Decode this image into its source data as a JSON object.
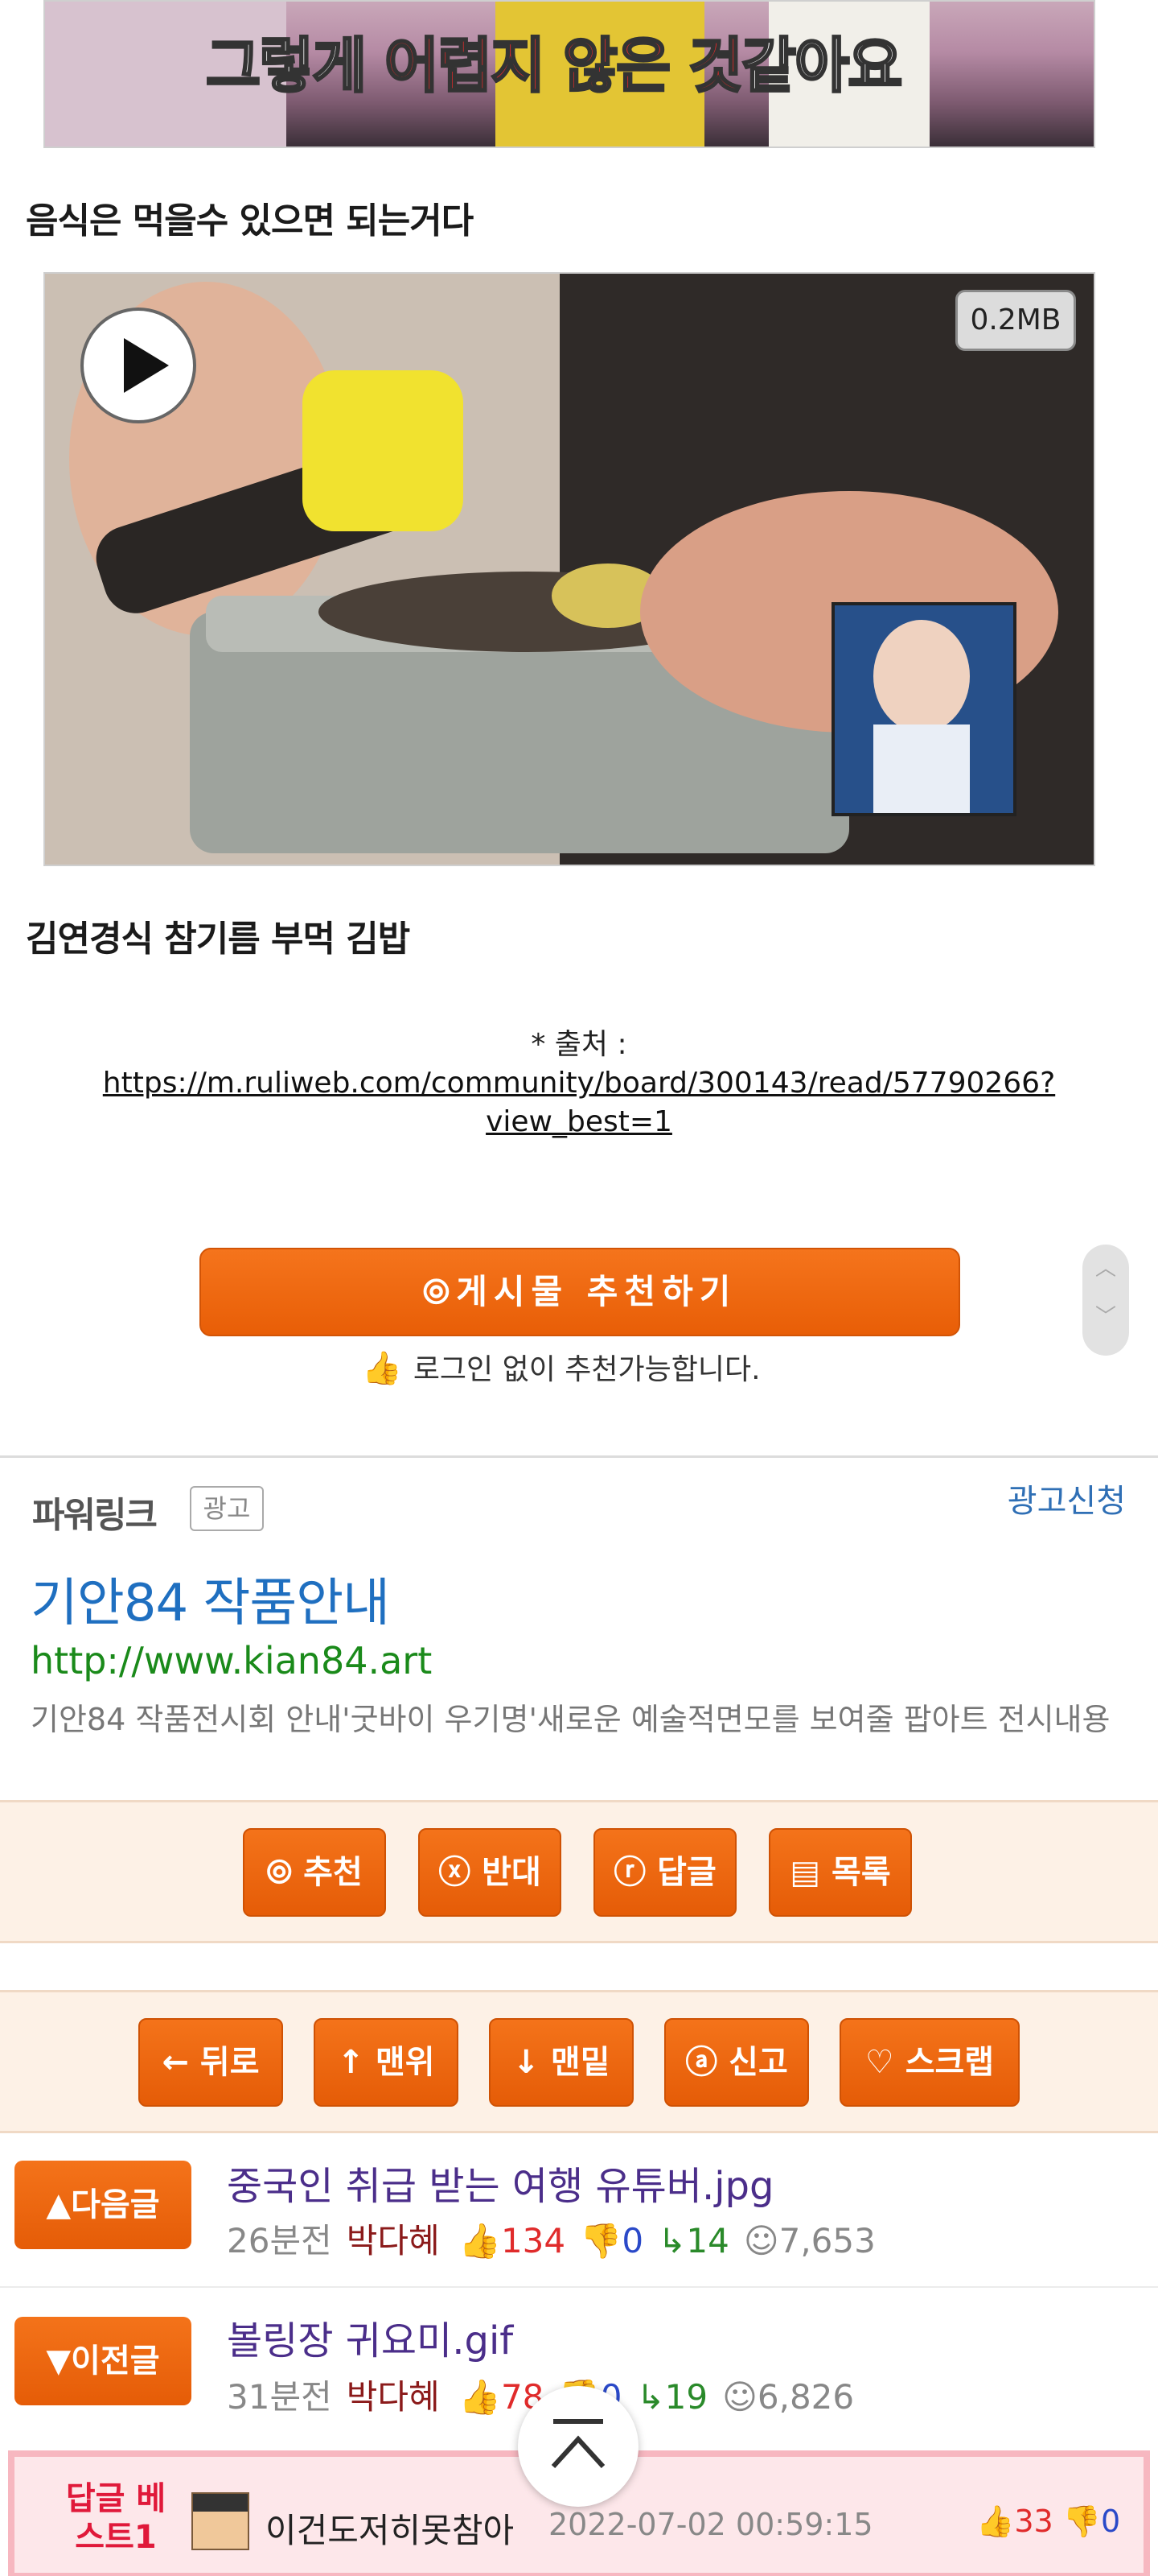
{
  "content": {
    "top_image_caption": "그렇게 어렵지 않은 것같아요",
    "caption_1": "음식은 먹을수 있으면 되는거다",
    "video_size_badge": "0.2MB",
    "caption_2": "김연경식 참기름 부먹 김밥",
    "source_prefix": "* 출처 : ",
    "source_url": "https://m.ruliweb.com/community/board/300143/read/57790266?view_best=1"
  },
  "recommend": {
    "button_label": "⦾게시물  추천하기",
    "note": "로그인 없이 추천가능합니다."
  },
  "powerlink": {
    "title": "파워링크",
    "badge": "광고",
    "apply": "광고신청",
    "ad_title": "기안84 작품안내",
    "ad_url": "http://www.kian84.art",
    "ad_desc": "기안84 작품전시회 안내'굿바이 우기명'새로운 예술적면모를 보여줄 팝아트 전시내용"
  },
  "actions": {
    "recommend": "⦾ 추천",
    "oppose": "ⓧ 반대",
    "reply": "ⓡ 답글",
    "list": "▤ 목록"
  },
  "nav_actions": {
    "back": "← 뒤로",
    "top": "↑ 맨위",
    "bottom": "↓ 맨밑",
    "report": "ⓐ 신고",
    "scrap": "♡ 스크랩"
  },
  "post_nav": [
    {
      "button": "▲다음글",
      "title": "중국인 취급 받는 여행 유튜버.jpg",
      "time": "26분전",
      "author": "박다혜",
      "up": "134",
      "down": "0",
      "replies": "14",
      "views": "7,653"
    },
    {
      "button": "▼이전글",
      "title": "볼링장 귀요미.gif",
      "time": "31분전",
      "author": "박다혜",
      "up": "78",
      "down": "0",
      "replies": "19",
      "views": "6,826"
    }
  ],
  "best_reply": {
    "label": "답글 베스트1",
    "author": "이건도저히못참아",
    "date": "2022-07-02 00:59:15",
    "up": "33",
    "down": "0"
  },
  "colors": {
    "accent": "#e85e07",
    "link": "#1f6fc0",
    "ad_url": "#1a8a1a",
    "upvote": "#e02b2b",
    "downvote": "#2a49c8"
  }
}
